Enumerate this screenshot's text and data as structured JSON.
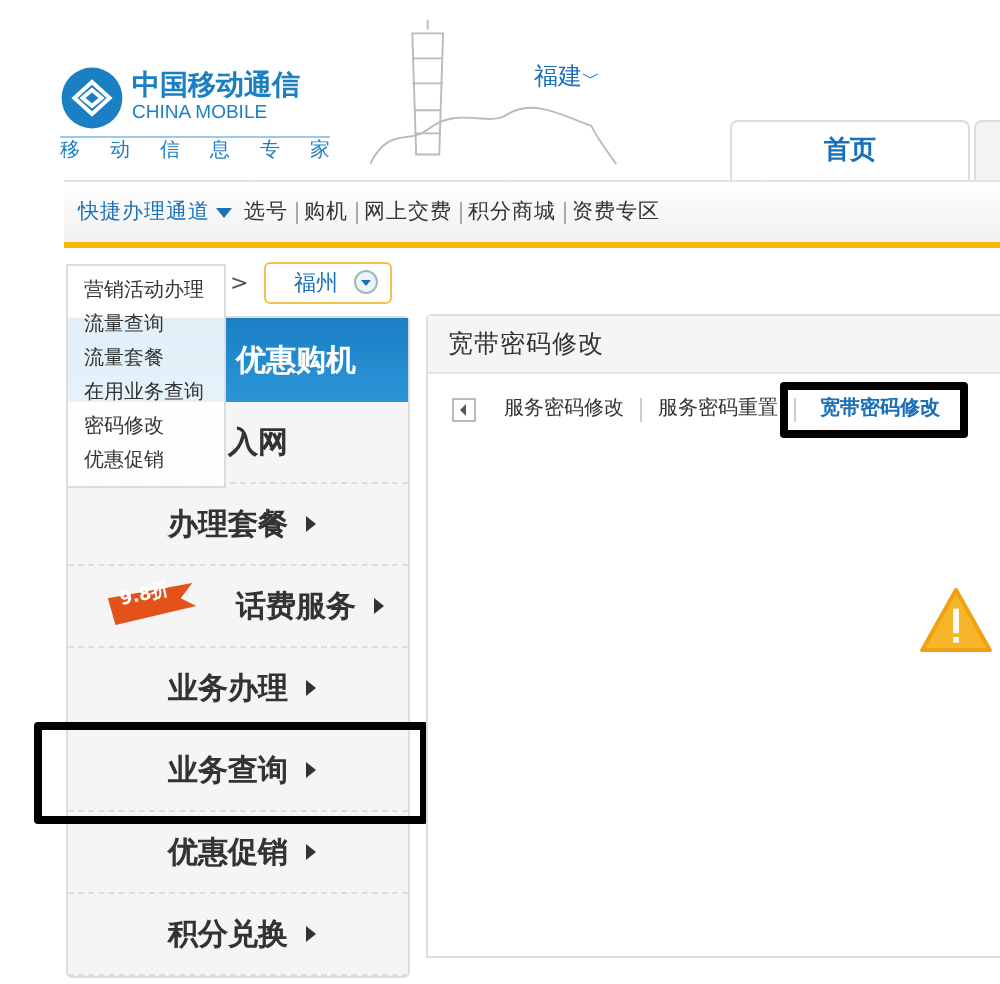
{
  "logo": {
    "name": "中国移动通信",
    "name_en": "CHINA MOBILE",
    "slogan": [
      "移",
      "动",
      "信",
      "息",
      "专",
      "家"
    ]
  },
  "region": {
    "label": "福建",
    "caret": "﹀"
  },
  "main_tabs": [
    {
      "label": "首页",
      "selected": true
    },
    {
      "selected": false
    }
  ],
  "quick_nav": {
    "label": "快捷办理通道",
    "links": [
      "选号",
      "购机",
      "网上交费",
      "积分商城",
      "资费专区"
    ]
  },
  "breadcrumb": {
    "separator": ">",
    "city": "福州"
  },
  "quick_menu": {
    "items": [
      "营销活动办理",
      "流量查询",
      "流量套餐",
      "在用业务查询",
      "密码修改",
      "优惠促销"
    ]
  },
  "sidebar": {
    "header": "优惠购机",
    "items": [
      {
        "label": "入网",
        "arrow": false,
        "highlighted": false
      },
      {
        "label": "办理套餐",
        "arrow": true,
        "highlighted": false
      },
      {
        "label": "话费服务",
        "arrow": true,
        "badge": "9.8折",
        "highlighted": false
      },
      {
        "label": "业务办理",
        "arrow": true,
        "highlighted": false
      },
      {
        "label": "业务查询",
        "arrow": true,
        "highlighted": true
      },
      {
        "label": "优惠促销",
        "arrow": true,
        "highlighted": false
      },
      {
        "label": "积分兑换",
        "arrow": true,
        "highlighted": false
      }
    ]
  },
  "panel": {
    "title": "宽带密码修改",
    "tabs": [
      {
        "label": "服务密码修改",
        "selected": false,
        "highlighted": false
      },
      {
        "label": "服务密码重置",
        "selected": false,
        "highlighted": false
      },
      {
        "label": "宽带密码修改",
        "selected": true,
        "highlighted": true
      }
    ]
  }
}
